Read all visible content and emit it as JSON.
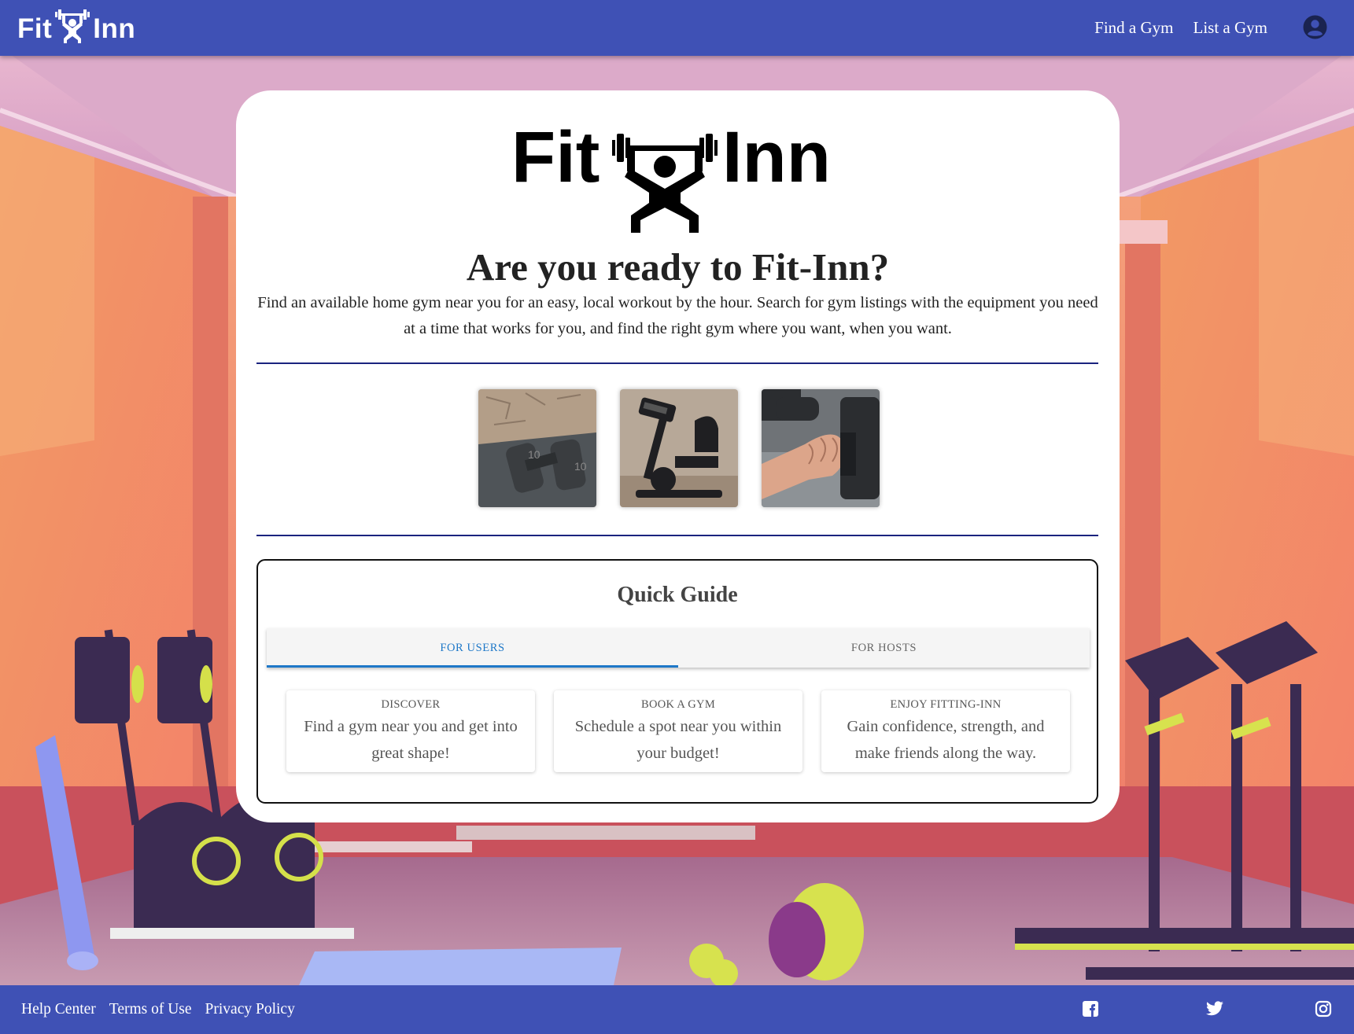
{
  "header": {
    "brand_left": "Fit",
    "brand_right": "Inn",
    "nav": [
      {
        "label": "Find a Gym"
      },
      {
        "label": "List a Gym"
      }
    ],
    "account_icon": "account-circle-icon"
  },
  "hero": {
    "logo_left": "Fit",
    "logo_right": "Inn",
    "title": "Are you ready to Fit-Inn?",
    "description": "Find an available home gym near you for an easy, local workout by the hour. Search for gym listings with the equipment you need at a time that works for you, and find the right gym where you want, when you want."
  },
  "photos": [
    {
      "subject": "dumbbells-on-mat"
    },
    {
      "subject": "recumbent-exercise-bike"
    },
    {
      "subject": "hand-gripping-dumbbell"
    }
  ],
  "guide": {
    "title": "Quick Guide",
    "tabs": [
      {
        "label": "FOR USERS",
        "active": true
      },
      {
        "label": "FOR HOSTS",
        "active": false
      }
    ],
    "steps": [
      {
        "label": "DISCOVER",
        "text": "Find a gym near you and get into great shape!"
      },
      {
        "label": "BOOK A GYM",
        "text": "Schedule a spot near you within your budget!"
      },
      {
        "label": "ENJOY FITTING-INN",
        "text": "Gain confidence, strength, and make friends along the way."
      }
    ]
  },
  "footer": {
    "links": [
      {
        "label": "Help Center"
      },
      {
        "label": "Terms of Use"
      },
      {
        "label": "Privacy Policy"
      }
    ],
    "social": [
      "facebook-icon",
      "twitter-icon",
      "instagram-icon"
    ]
  },
  "colors": {
    "primary": "#3f51b5",
    "accent": "#1e78c8",
    "divider": "#1a237e"
  }
}
